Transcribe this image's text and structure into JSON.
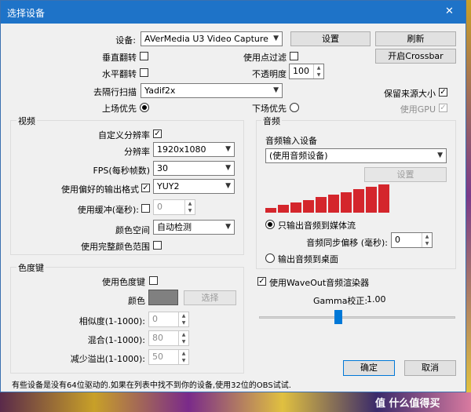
{
  "window": {
    "title": "选择设备",
    "close_glyph": "✕"
  },
  "device": {
    "label": "设备:",
    "value": "AVerMedia U3 Video Capture",
    "settings_button": "设置",
    "refresh_button": "刷新",
    "crossbar_button": "开启Crossbar"
  },
  "options": {
    "vflip": "垂直翻转",
    "hflip": "水平翻转",
    "point_filter": "使用点过滤",
    "opacity_label": "不透明度",
    "opacity_value": "100",
    "deinterlace_label": "去隔行扫描",
    "deinterlace_value": "Yadif2x",
    "keep_source_size": "保留来源大小",
    "keep_source_size_checked": true,
    "top_field_first": "上场优先",
    "bottom_field_first": "下场优先",
    "use_gpu": "使用GPU"
  },
  "video": {
    "group": "视频",
    "custom_resolution": "自定义分辨率",
    "resolution_label": "分辨率",
    "resolution_value": "1920x1080",
    "fps_label": "FPS(每秒帧数)",
    "fps_value": "30",
    "pref_format_label": "使用偏好的输出格式",
    "pref_format_value": "YUY2",
    "buffer_label": "使用缓冲(毫秒):",
    "buffer_value": "0",
    "color_space_label": "颜色空间",
    "color_space_value": "自动检测",
    "full_range": "使用完整颜色范围"
  },
  "audio": {
    "group": "音频",
    "input_label": "音频输入设备",
    "input_value": "(使用音频设备)",
    "settings_button": "设置",
    "meter_levels": [
      0.18,
      0.27,
      0.36,
      0.45,
      0.55,
      0.64,
      0.73,
      0.82,
      0.91,
      1.0
    ],
    "meter_color": "#d4262c",
    "output_stream": "只输出音频到媒体流",
    "sync_label": "音频同步偏移 (毫秒):",
    "sync_value": "0",
    "output_desktop": "输出音频到桌面",
    "waveout": "使用WaveOut音频渲染器",
    "gamma_label": "Gamma校正:",
    "gamma_value": "1.00",
    "gamma_fraction": 0.5
  },
  "chroma": {
    "group": "色度键",
    "use_label": "使用色度键",
    "color_label": "颜色",
    "color_swatch": "#808080",
    "select_button": "选择",
    "similarity_label": "相似度(1-1000):",
    "similarity_value": "0",
    "blend_label": "混合(1-1000):",
    "blend_value": "80",
    "spill_label": "减少溢出(1-1000):",
    "spill_value": "50"
  },
  "footer": {
    "ok_button": "确定",
    "cancel_button": "取消",
    "note": "有些设备是没有64位驱动的.如果在列表中找不到你的设备,使用32位的OBS试试."
  },
  "watermark": "值 什么值得买",
  "colors": {
    "title_bar": "#1e73c8",
    "accent": "#0078d7"
  }
}
